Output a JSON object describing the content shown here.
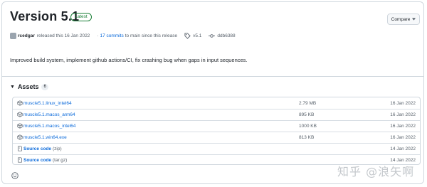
{
  "release": {
    "title": "Version 5.1",
    "badge": "Latest",
    "compare_label": "Compare",
    "author": "rcedgar",
    "released_text": "released this 16 Jan 2022",
    "commits_link": "17 commits",
    "commits_suffix": "to main since this release",
    "tag": "v5.1",
    "commit_hash": "ddb6388",
    "description": "Improved build system, implement github actions/CI, fix crashing bug when gaps in input sequences."
  },
  "assets": {
    "heading": "Assets",
    "count": "6",
    "rows": [
      {
        "name": "muscle5.1.linux_intel64",
        "size": "2.79 MB",
        "date": "16 Jan 2022"
      },
      {
        "name": "muscle5.1.macos_arm64",
        "size": "895 KB",
        "date": "16 Jan 2022"
      },
      {
        "name": "muscle5.1.macos_intel64",
        "size": "1000 KB",
        "date": "16 Jan 2022"
      },
      {
        "name": "muscle5.1.win64.exe",
        "size": "813 KB",
        "date": "16 Jan 2022"
      },
      {
        "name": "Source code",
        "sub": "(zip)",
        "size": "",
        "date": "14 Jan 2022"
      },
      {
        "name": "Source code",
        "sub": "(tar.gz)",
        "size": "",
        "date": "14 Jan 2022"
      }
    ]
  },
  "watermark": "知乎 @浪矢啊",
  "icons": {
    "package": "package-icon",
    "zip": "file-zip-icon",
    "tag": "tag-icon",
    "commit": "git-commit-icon",
    "smiley": "smiley-icon",
    "caret": "triangle-down-icon"
  },
  "colors": {
    "link": "#0969da",
    "latest": "#1a7f37",
    "border": "#d0d7de"
  }
}
